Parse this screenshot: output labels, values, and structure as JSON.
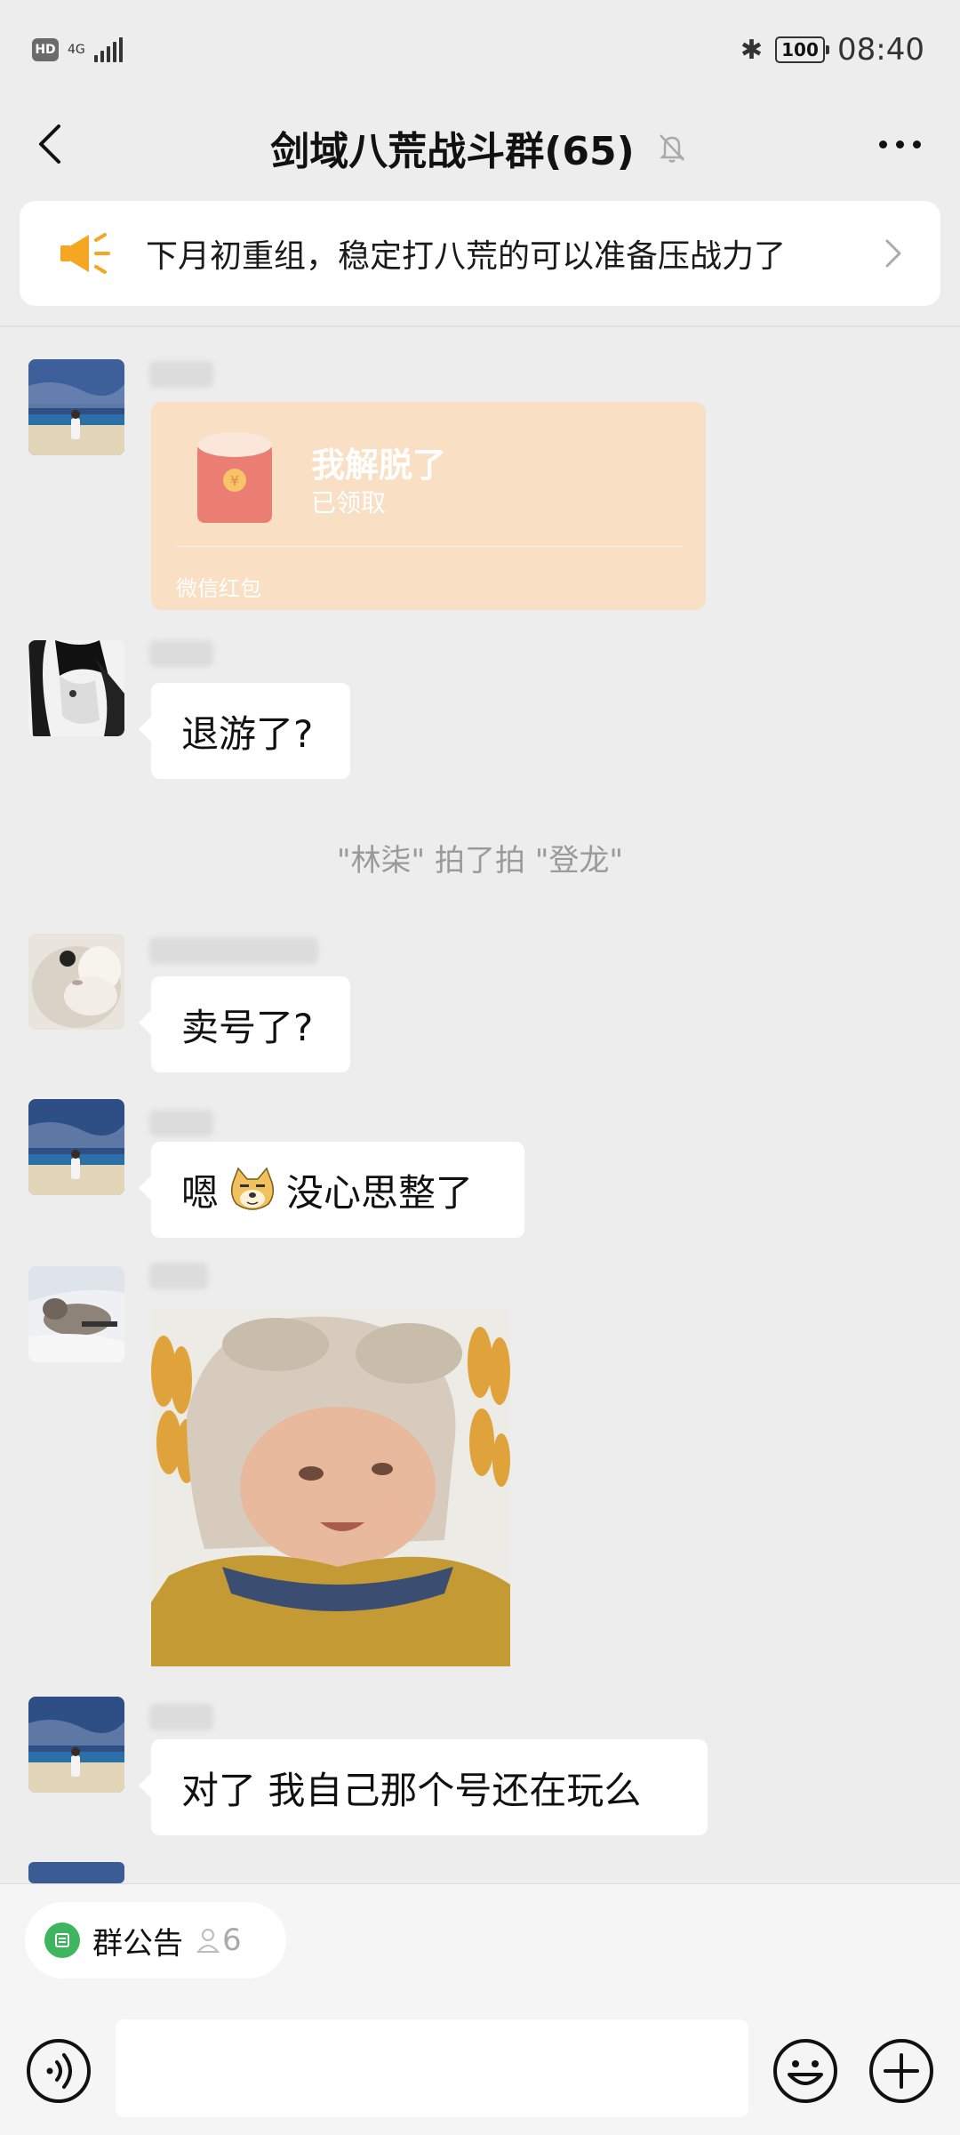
{
  "status_bar": {
    "hd": "HD",
    "network": "4G",
    "battery": "100",
    "time": "08:40"
  },
  "header": {
    "title": "剑域八荒战斗群(65)"
  },
  "announcement": {
    "text": "下月初重组，稳定打八荒的可以准备压战力了"
  },
  "messages": {
    "red_packet": {
      "title": "我解脱了",
      "status": "已领取",
      "label": "微信红包"
    },
    "msg1": "退游了?",
    "system": "\"林柒\" 拍了拍 \"登龙\"",
    "msg2": "卖号了?",
    "msg3_a": "嗯",
    "msg3_b": "没心思整了",
    "msg4": "对了 我自己那个号还在玩么"
  },
  "bottom": {
    "group_notice_label": "群公告",
    "group_notice_count": "6"
  },
  "colors": {
    "background": "#ededed",
    "bubble": "#ffffff",
    "red_packet": "#f9dfc3",
    "megaphone": "#f5a623",
    "notice_green": "#3fb55f"
  }
}
